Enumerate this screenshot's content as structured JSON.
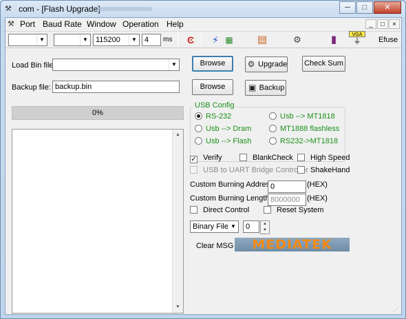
{
  "window": {
    "title": "com - [Flash Upgrade]",
    "controls": {
      "minimize": "─",
      "maximize": "□",
      "close": "✕"
    }
  },
  "menu": {
    "items": [
      "Port",
      "Baud Rate",
      "Window",
      "Operation",
      "Help"
    ],
    "mdi_controls": {
      "minimize": "_",
      "restore": "□",
      "close": "×"
    }
  },
  "toolbar": {
    "port_value": "",
    "second_value": "",
    "baud_value": "115200",
    "timeout_value": "4",
    "timeout_unit": "ms",
    "efuse_label": "Efuse",
    "vga_label": "VGA"
  },
  "files": {
    "load_bin_label": "Load Bin file:",
    "load_bin_value": "",
    "backup_label": "Backup file:",
    "backup_value": "backup.bin"
  },
  "buttons": {
    "browse_1": "Browse",
    "upgrade": "Upgrade",
    "check_sum": "Check Sum",
    "browse_2": "Browse",
    "backup": "Backup",
    "clear_msg": "Clear MSG"
  },
  "progress": {
    "text": "0%",
    "value": 0
  },
  "usb_config": {
    "title": "USB Config",
    "options": [
      {
        "label": "RS-232",
        "selected": true
      },
      {
        "label": "Usb --> MT1818",
        "selected": false
      },
      {
        "label": "Usb --> Dram",
        "selected": false
      },
      {
        "label": "MT1888 flashless",
        "selected": false
      },
      {
        "label": "Usb --> Flash",
        "selected": false
      },
      {
        "label": "RS232->MT1818",
        "selected": false
      }
    ]
  },
  "options": {
    "verify": {
      "label": "Verify",
      "checked": true
    },
    "blankcheck": {
      "label": "BlankCheck",
      "checked": false
    },
    "high_speed": {
      "label": "High Speed",
      "checked": false
    },
    "usb_uart": {
      "label": "USB to UART Bridge Controller",
      "checked": false,
      "disabled": true
    },
    "shakehand": {
      "label": "ShakeHand",
      "checked": false
    },
    "direct_control": {
      "label": "Direct Control",
      "checked": false
    },
    "reset_system": {
      "label": "Reset System",
      "checked": false
    }
  },
  "custom": {
    "address_label": "Custom Burning  Address :",
    "address_value": "0",
    "address_unit": "(HEX)",
    "length_label": "Custom Burning  Length:",
    "length_value": "8000000",
    "length_unit": "(HEX)"
  },
  "file_type": {
    "value": "Binary File",
    "spin_value": "0"
  },
  "logo": {
    "text": "MEDIATEK",
    "color": "#f28a16"
  },
  "colors": {
    "group_accent": "#1a8f1a",
    "default_button": "#3c7fb1"
  }
}
